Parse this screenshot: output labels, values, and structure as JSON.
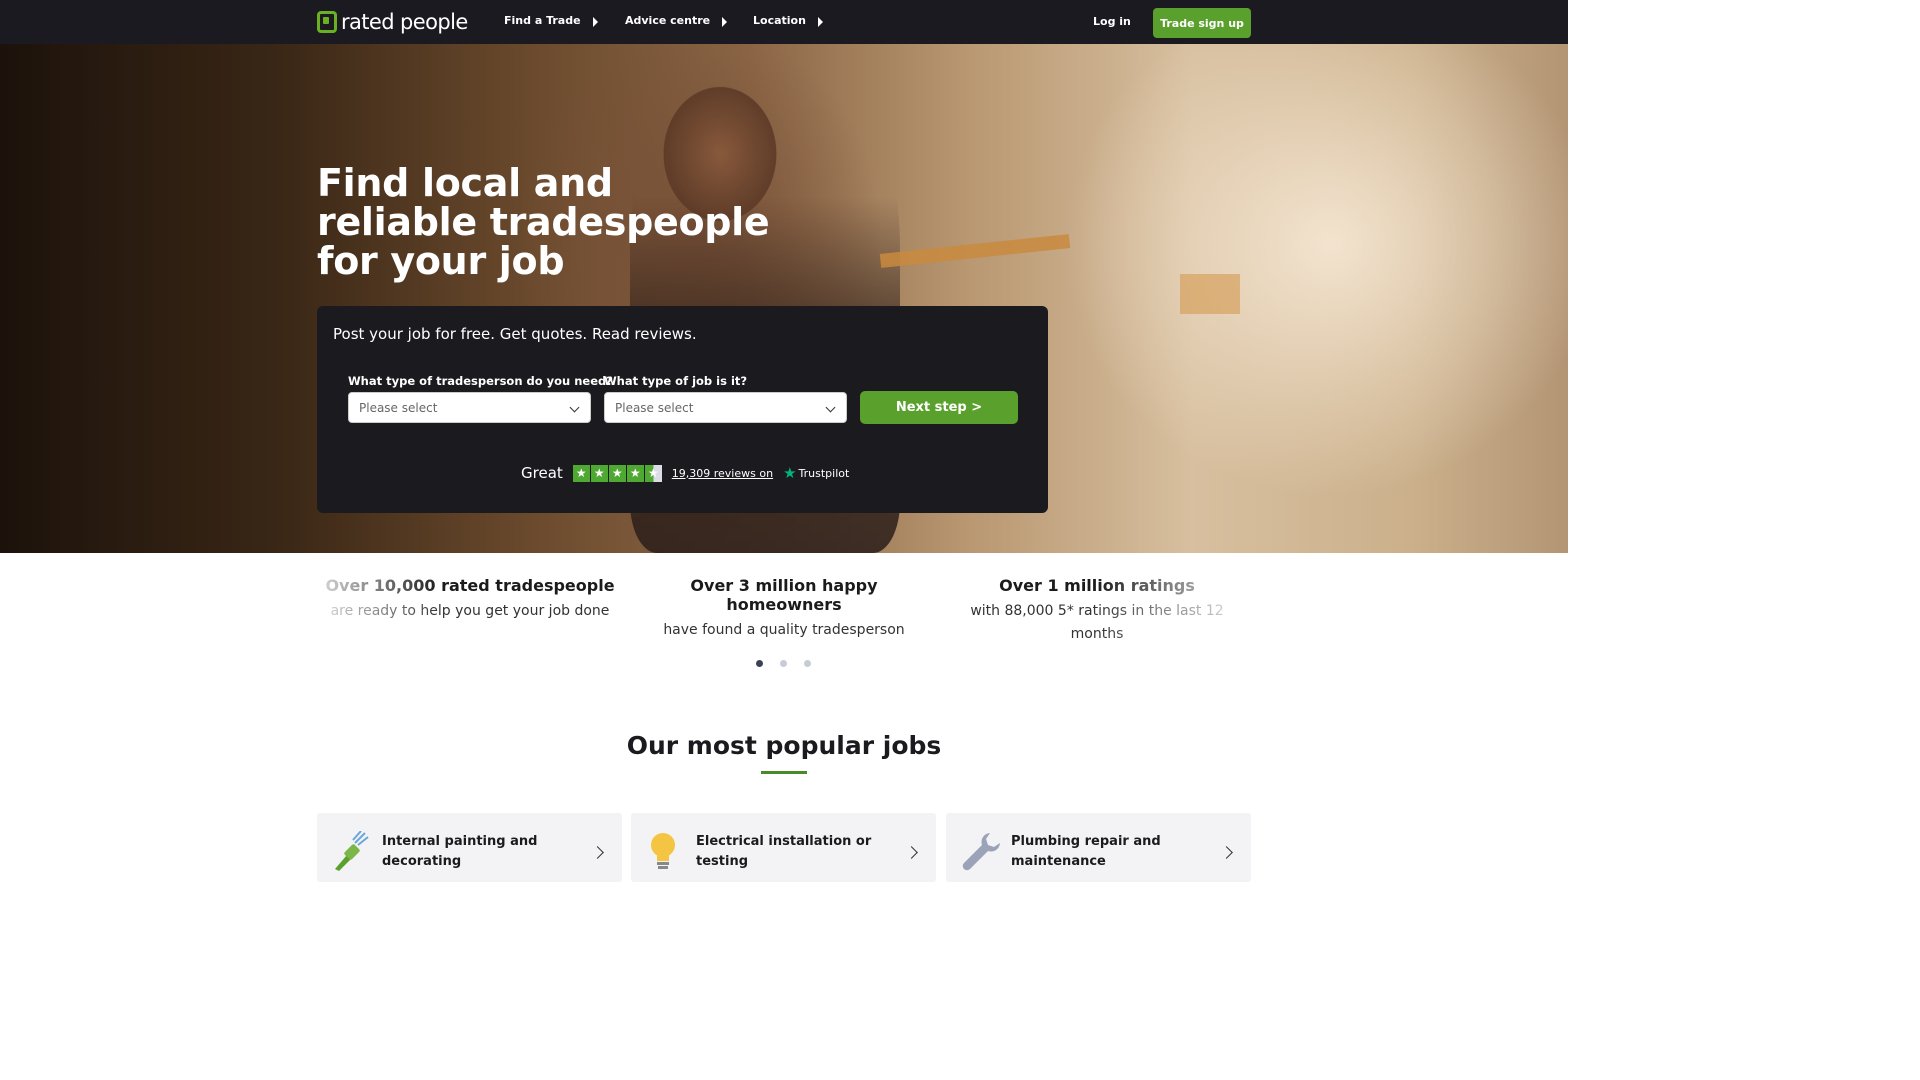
{
  "nav": {
    "logo_text": "rated people",
    "items": [
      {
        "label": "Find a Trade"
      },
      {
        "label": "Advice centre"
      },
      {
        "label": "Location"
      }
    ],
    "login_label": "Log in",
    "signup_label": "Trade sign up"
  },
  "hero": {
    "title": "Find local and reliable tradespeople for your job",
    "search": {
      "lead": "Post your job for free. Get quotes. Read reviews.",
      "trade_label": "What type of tradesperson do you need?",
      "trade_placeholder": "Please select",
      "job_label": "What type of job is it?",
      "job_placeholder": "Please select",
      "next_label": "Next step >"
    },
    "trustpilot": {
      "rating_word": "Great",
      "stars": 4.5,
      "reviews_link": "19,309 reviews on",
      "brand": "Trustpilot"
    }
  },
  "stats": [
    {
      "head": "Over 10,000 rated tradespeople",
      "sub": "are ready to help you get your job done"
    },
    {
      "head": "Over 3 million happy homeowners",
      "sub": "have found a quality tradesperson"
    },
    {
      "head": "Over 1 million ratings",
      "sub": "with 88,000 5* ratings in the last 12 months"
    }
  ],
  "carousel": {
    "active_index": 0,
    "count": 3
  },
  "popular": {
    "title": "Our most popular jobs",
    "jobs": [
      {
        "label": "Internal painting and decorating",
        "icon": "paintbrush-icon"
      },
      {
        "label": "Electrical installation or testing",
        "icon": "lightbulb-icon"
      },
      {
        "label": "Plumbing repair and maintenance",
        "icon": "wrench-icon"
      }
    ]
  },
  "colors": {
    "brand_green": "#5aa02c",
    "nav_bg": "#1b1a21",
    "trustpilot_green": "#00b67a"
  }
}
